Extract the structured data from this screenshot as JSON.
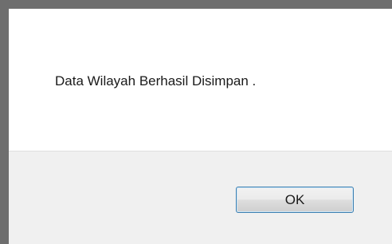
{
  "dialog": {
    "message": "Data Wilayah Berhasil Disimpan .",
    "ok_label": "OK"
  },
  "colors": {
    "backdrop": "#6e6e6e",
    "dialog_body": "#ffffff",
    "button_bar": "#f0f0f0",
    "button_border": "#3c7fb1"
  }
}
